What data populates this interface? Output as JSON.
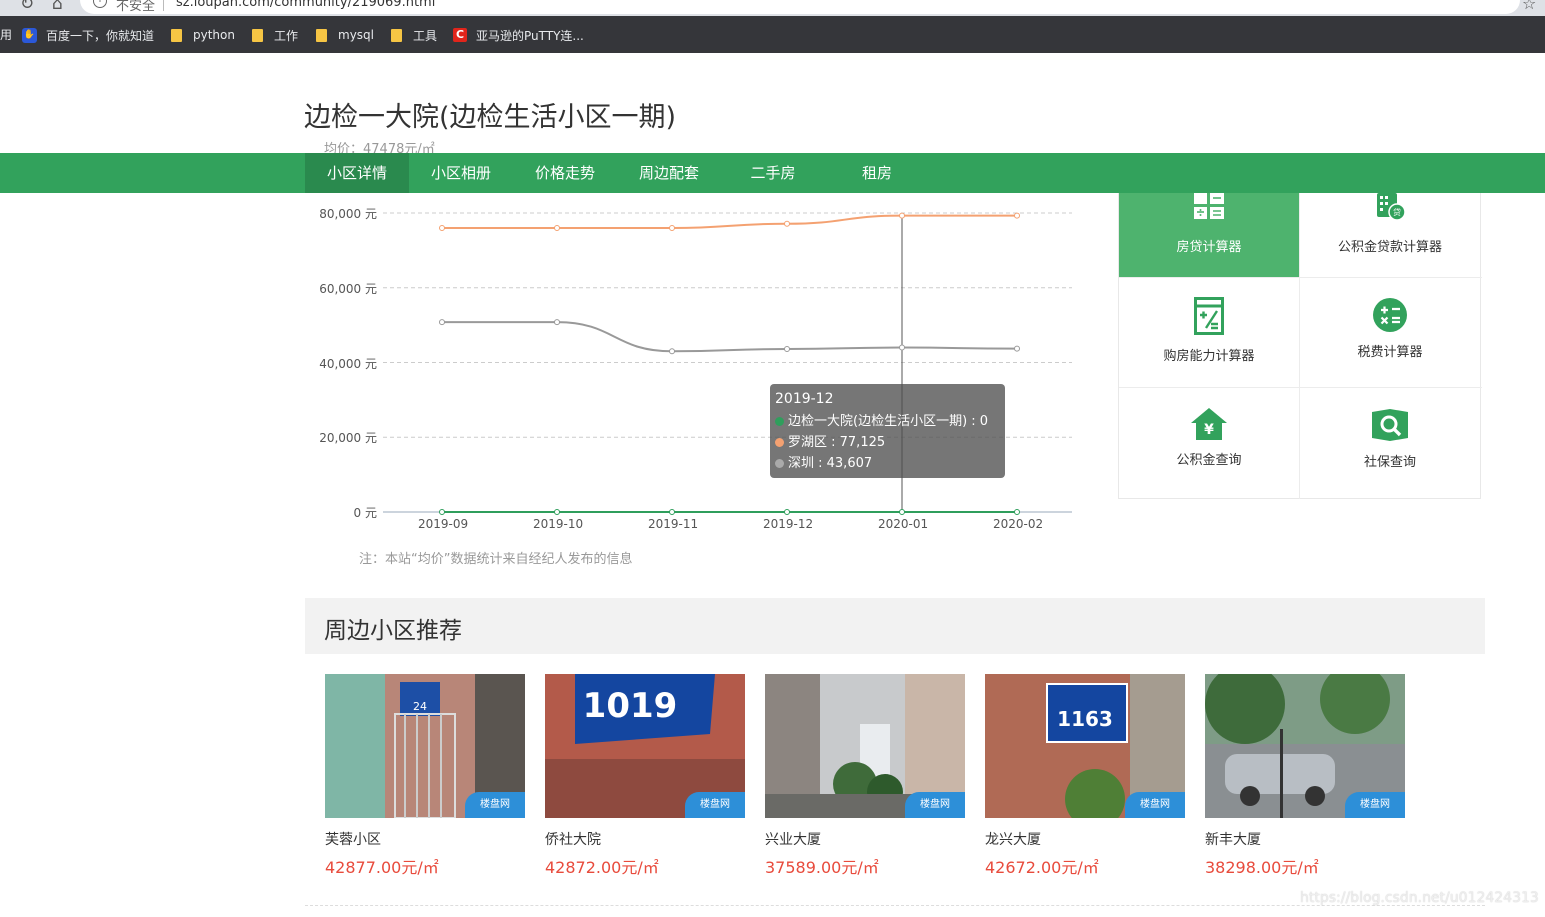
{
  "browser": {
    "security_label": "不安全",
    "url": "sz.loupan.com/community/219069.html",
    "bookmarks_partial": "用",
    "bookmarks": [
      {
        "label": "百度一下，你就知道",
        "icon": "baidu-icon"
      },
      {
        "label": "python",
        "icon": "folder-icon"
      },
      {
        "label": "工作",
        "icon": "folder-icon"
      },
      {
        "label": "mysql",
        "icon": "folder-icon"
      },
      {
        "label": "工具",
        "icon": "folder-icon"
      },
      {
        "label": "亚马逊的PuTTY连...",
        "icon": "putty-icon"
      }
    ]
  },
  "page": {
    "title": "边检一大院(边检生活小区一期)",
    "avg_price": "均价：47478元/㎡"
  },
  "nav": {
    "items": [
      "小区详情",
      "小区相册",
      "价格走势",
      "周边配套",
      "二手房",
      "租房"
    ],
    "active_index": 0,
    "accent": "#32a25c"
  },
  "chart_data": {
    "type": "line",
    "categories": [
      "2019-09",
      "2019-10",
      "2019-11",
      "2019-12",
      "2020-01",
      "2020-02"
    ],
    "y_tick_labels": [
      "0 元",
      "20,000 元",
      "40,000 元",
      "60,000 元",
      "80,000 元"
    ],
    "ylim": [
      0,
      80000
    ],
    "grid": true,
    "series": [
      {
        "name": "边检一大院(边检生活小区一期)",
        "color": "#2f9e5c",
        "values": [
          0,
          0,
          0,
          0,
          0,
          0
        ]
      },
      {
        "name": "罗湖区",
        "color": "#f4a171",
        "values": [
          76000,
          76000,
          76000,
          77125,
          79300,
          79300
        ]
      },
      {
        "name": "深圳",
        "color": "#999999",
        "values": [
          50800,
          50800,
          43000,
          43607,
          44000,
          43700
        ]
      }
    ],
    "tooltip": {
      "title": "2019-12",
      "rows": [
        {
          "text": "边检一大院(边检生活小区一期) : 0",
          "color": "#2f9e5c"
        },
        {
          "text": "罗湖区 : 77,125",
          "color": "#f4a171"
        },
        {
          "text": "深圳 : 43,607",
          "color": "#aaaaaa"
        }
      ]
    },
    "crosshair_category": "2020-01"
  },
  "chart_note": "注：本站“均价”数据统计来自经纪人发布的信息",
  "calculators": [
    {
      "label": "房贷计算器",
      "icon": "calculator-icon",
      "active": true
    },
    {
      "label": "公积金贷款计算器",
      "icon": "loan-calculator-icon",
      "active": false
    },
    {
      "label": "购房能力计算器",
      "icon": "ability-calculator-icon",
      "active": false
    },
    {
      "label": "税费计算器",
      "icon": "tax-calculator-icon",
      "active": false
    },
    {
      "label": "公积金查询",
      "icon": "fund-house-icon",
      "active": false
    },
    {
      "label": "社保查询",
      "icon": "social-security-search-icon",
      "active": false
    }
  ],
  "recommend": {
    "title": "周边小区推荐",
    "items": [
      {
        "name": "芙蓉小区",
        "price": "42877.00元/㎡"
      },
      {
        "name": "侨社大院",
        "price": "42872.00元/㎡"
      },
      {
        "name": "兴业大厦",
        "price": "37589.00元/㎡"
      },
      {
        "name": "龙兴大厦",
        "price": "42672.00元/㎡"
      },
      {
        "name": "新丰大厦",
        "price": "38298.00元/㎡"
      }
    ],
    "sign_texts": [
      "24",
      "1019",
      "1163"
    ],
    "watermark": "楼盘网"
  },
  "footer_watermark": "https://blog.csdn.net/u012424313"
}
